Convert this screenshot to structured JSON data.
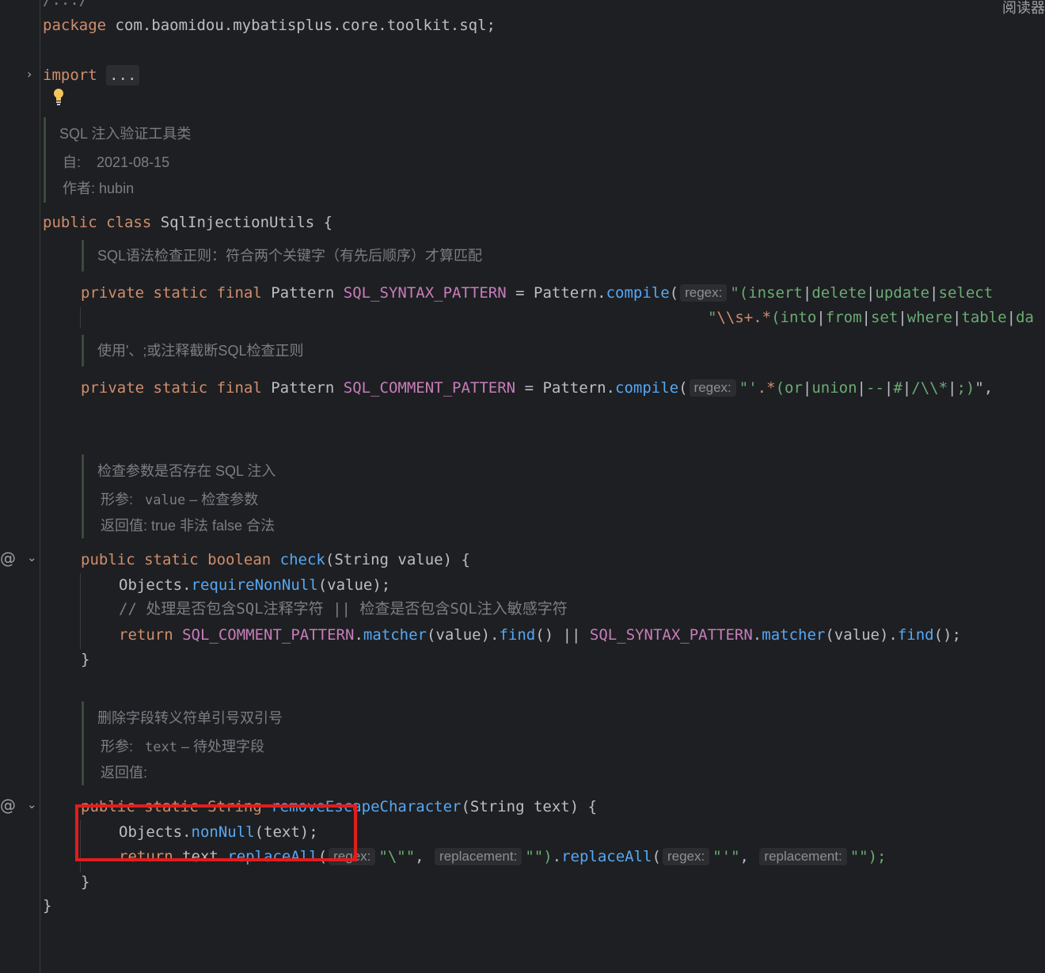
{
  "corner_label": "阅读器",
  "top_fold": "/.../",
  "package_line": {
    "keyword": "package",
    "name": "com.baomidou.mybatisplus.core.toolkit.sql;"
  },
  "import_line": {
    "keyword": "import",
    "dots": "..."
  },
  "class_doc": {
    "title": "SQL 注入验证工具类",
    "since_label": "自:",
    "since_value": "2021-08-15",
    "author_label": "作者:",
    "author_value": "hubin"
  },
  "class_decl": {
    "mods": "public class",
    "name": "SqlInjectionUtils",
    "brace": "{"
  },
  "syntax_doc": "SQL语法检查正则：符合两个关键字（有先后顺序）才算匹配",
  "syntax_field": {
    "mods": "private static final",
    "type": "Pattern",
    "name": "SQL_SYNTAX_PATTERN",
    "eq": "=",
    "call_cls": "Pattern",
    "call_method": "compile",
    "hint": "regex:",
    "line1_parts": [
      "\"(insert",
      "|",
      "delete",
      "|",
      "update",
      "|",
      "select"
    ],
    "line2_parts": [
      "\"",
      "\\\\s+.*",
      "(into",
      "|",
      "from",
      "|",
      "set",
      "|",
      "where",
      "|",
      "table",
      "|",
      "da"
    ]
  },
  "comment_doc": "使用'、;或注释截断SQL检查正则",
  "comment_field": {
    "mods": "private static final",
    "type": "Pattern",
    "name": "SQL_COMMENT_PATTERN",
    "eq": "=",
    "call_cls": "Pattern",
    "call_method": "compile",
    "hint": "regex:",
    "parts": [
      "\"'",
      ".*",
      "(or",
      "|",
      "union",
      "|",
      "--",
      "|",
      "#",
      "|",
      "/\\\\*",
      "|",
      ";)",
      "\","
    ]
  },
  "check_doc": {
    "title": "检查参数是否存在 SQL 注入",
    "param_label": "形参:",
    "param_name": "value",
    "param_desc": "– 检查参数",
    "return_label": "返回值:",
    "return_desc": "true 非法 false 合法"
  },
  "check_method": {
    "mods": "public static boolean",
    "name": "check",
    "signature": "(String value) {",
    "line1_cls": "Objects",
    "line1_method": "requireNonNull",
    "line1_args": "(value);",
    "comment": "// 处理是否包含SQL注释字符 || 检查是否包含SQL注入敏感字符",
    "ret_kw": "return",
    "ret_c1": "SQL_COMMENT_PATTERN",
    "ret_m1": "matcher",
    "ret_a1": "(value).",
    "ret_f1": "find",
    "ret_or": "() || ",
    "ret_c2": "SQL_SYNTAX_PATTERN",
    "ret_m2": "matcher",
    "ret_a2": "(value).",
    "ret_f2": "find",
    "ret_end": "();",
    "close": "}"
  },
  "escape_doc": {
    "title": "删除字段转义符单引号双引号",
    "param_label": "形参:",
    "param_name": "text",
    "param_desc": "– 待处理字段",
    "return_label": "返回值:"
  },
  "escape_method": {
    "mods": "public static String",
    "name": "removeEscapeCharacter",
    "signature": "(String text) {",
    "line1_cls": "Objects",
    "line1_method": "nonNull",
    "line1_args": "(text);",
    "ret_kw": "return",
    "ret_target": "text.",
    "ret_method": "replaceAll",
    "hint_regex": "regex:",
    "arg1": "\"\\\"\"",
    "hint_replacement": "replacement:",
    "arg2": "\"\")",
    "arg3": "\"'\"",
    "arg4": "\"\");",
    "close": "}"
  },
  "class_close": "}"
}
